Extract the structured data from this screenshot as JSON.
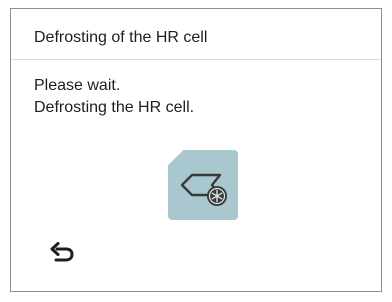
{
  "screen": {
    "title": "Defrosting of the HR cell",
    "message_lines": [
      "Please wait.",
      "Defrosting the HR cell."
    ],
    "status_icon": "hr-cell-defrost-icon",
    "back_icon": "back-arrow-icon"
  },
  "colors": {
    "text": "#1e1e1e",
    "border": "#8f8f8f",
    "icon_tile": "#a9c7cf",
    "icon_stroke": "#3a3a3a"
  }
}
